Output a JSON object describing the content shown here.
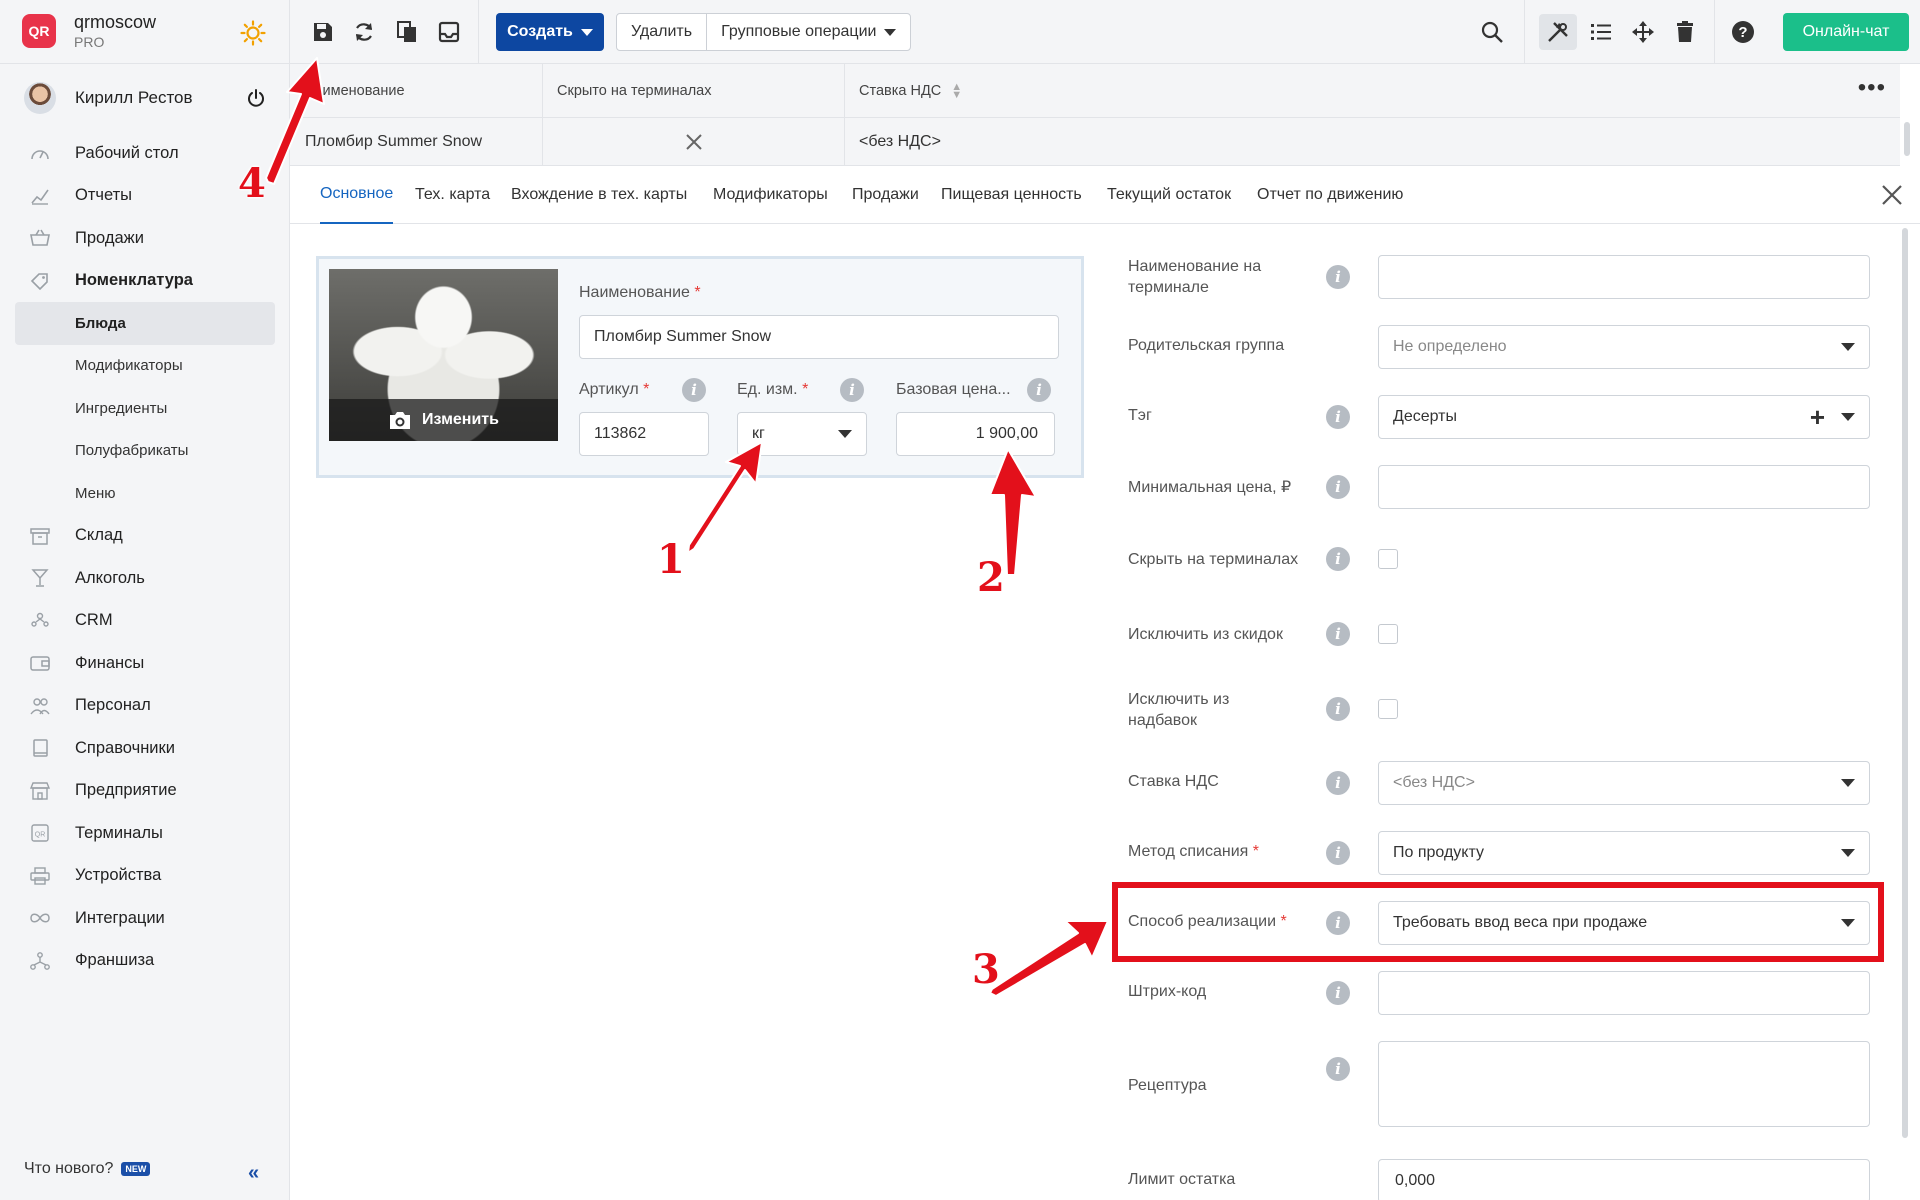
{
  "brand": {
    "name": "qrmoscow",
    "plan": "PRO",
    "logo_text": "QR"
  },
  "user": {
    "name": "Кирилл Рестов"
  },
  "nav": {
    "items": [
      {
        "label": "Рабочий стол",
        "icon": "speedometer-icon"
      },
      {
        "label": "Отчеты",
        "icon": "chart-icon"
      },
      {
        "label": "Продажи",
        "icon": "basket-icon"
      },
      {
        "label": "Номенклатура",
        "icon": "tag-icon"
      }
    ],
    "sub_items": [
      "Блюда",
      "Модификаторы",
      "Ингредиенты",
      "Полуфабрикаты",
      "Меню"
    ],
    "items2": [
      {
        "label": "Склад",
        "icon": "archive-icon"
      },
      {
        "label": "Алкоголь",
        "icon": "glass-icon"
      },
      {
        "label": "CRM",
        "icon": "people-icon"
      },
      {
        "label": "Финансы",
        "icon": "wallet-icon"
      },
      {
        "label": "Персонал",
        "icon": "staff-icon"
      },
      {
        "label": "Справочники",
        "icon": "book-icon"
      },
      {
        "label": "Предприятие",
        "icon": "store-icon"
      },
      {
        "label": "Терминалы",
        "icon": "qr-icon"
      },
      {
        "label": "Устройства",
        "icon": "printer-icon"
      },
      {
        "label": "Интеграции",
        "icon": "infinity-icon"
      },
      {
        "label": "Франшиза",
        "icon": "network-icon"
      }
    ],
    "whats_new": "Что нового?",
    "new_badge": "NEW"
  },
  "toolbar": {
    "create_label": "Создать",
    "delete_label": "Удалить",
    "group_ops_label": "Групповые операции",
    "chat_label": "Онлайн-чат"
  },
  "grid": {
    "columns": [
      "Наименование",
      "Скрыто на терминалах",
      "Ставка НДС"
    ],
    "row": {
      "name": "Пломбир Summer Snow",
      "vat": "<без НДС>"
    }
  },
  "tabs": [
    "Основное",
    "Тех. карта",
    "Вхождение в тех. карты",
    "Модификаторы",
    "Продажи",
    "Пищевая ценность",
    "Текущий остаток",
    "Отчет по движению"
  ],
  "card": {
    "photo_button": "Изменить",
    "name_label": "Наименование",
    "name_value": "Пломбир Summer Snow",
    "sku_label": "Артикул",
    "sku_value": "113862",
    "unit_label": "Ед. изм.",
    "unit_value": "кг",
    "price_label": "Базовая цена...",
    "price_value": "1 900,00"
  },
  "form": {
    "terminal_name_label": "Наименование на терминале",
    "terminal_name_value": "",
    "parent_group_label": "Родительская группа",
    "parent_group_value": "Не определено",
    "tag_label": "Тэг",
    "tag_value": "Десерты",
    "min_price_label": "Минимальная цена, ₽",
    "min_price_value": "",
    "hide_terminals_label": "Скрыть на терминалах",
    "exclude_discounts_label": "Исключить из скидок",
    "exclude_markups_label": "Исключить из надбавок",
    "vat_label": "Ставка НДС",
    "vat_value": "<без НДС>",
    "writeoff_label": "Метод списания",
    "writeoff_value": "По продукту",
    "sale_method_label": "Способ реализации",
    "sale_method_value": "Требовать ввод веса при продаже",
    "barcode_label": "Штрих-код",
    "barcode_value": "",
    "recipe_label": "Рецептура",
    "recipe_value": "",
    "stock_limit_label": "Лимит остатка",
    "stock_limit_value": "0,000"
  },
  "annotations": {
    "n1": "1",
    "n2": "2",
    "n3": "3",
    "n4": "4",
    "color": "#e3101b"
  },
  "colors": {
    "primary": "#0d47a1",
    "chat": "#1bbf8a",
    "brand": "#e8334a",
    "tab_active": "#1565c0"
  }
}
